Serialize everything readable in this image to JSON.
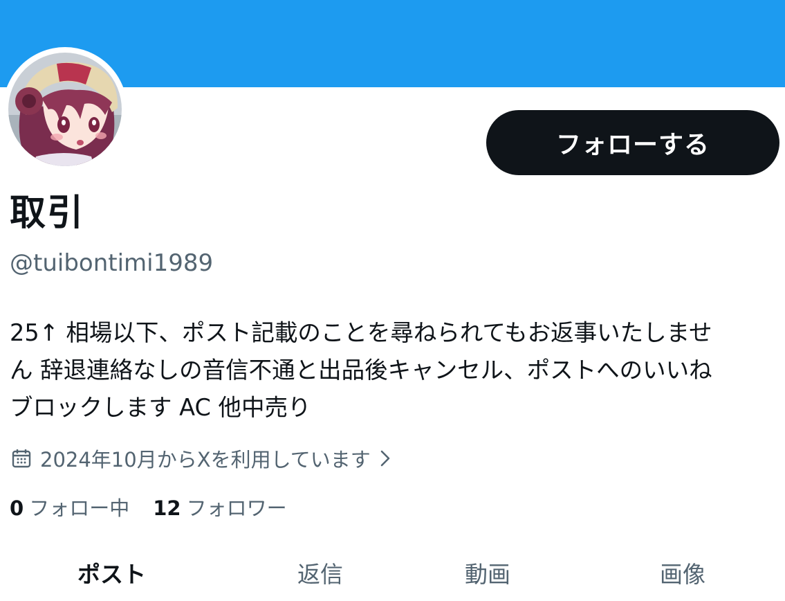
{
  "colors": {
    "banner": "#1d9bf0",
    "primary_text": "#0f1419",
    "secondary_text": "#536471",
    "button_bg": "#0f1419",
    "button_text": "#ffffff"
  },
  "profile": {
    "display_name": "取引",
    "handle": "@tuibontimi1989",
    "avatar_icon": "anime-character-avatar",
    "follow_button_label": "フォローする",
    "bio_lines": [
      "25↑ 相場以下、ポスト記載のことを尋ねられてもお返事いたしませ",
      "ん 辞退連絡なしの音信不通と出品後キャンセル、ポストへのいいね",
      "ブロックします AC 他中売り"
    ],
    "joined_icon": "calendar-icon",
    "joined_text": "2024年10月からXを利用しています",
    "joined_chevron_icon": "chevron-right-icon",
    "following_count": "0",
    "following_label": "フォロー中",
    "followers_count": "12",
    "followers_label": "フォロワー"
  },
  "tabs": [
    {
      "label": "ポスト",
      "active": true
    },
    {
      "label": "返信",
      "active": false
    },
    {
      "label": "動画",
      "active": false
    },
    {
      "label": "画像",
      "active": false
    }
  ]
}
